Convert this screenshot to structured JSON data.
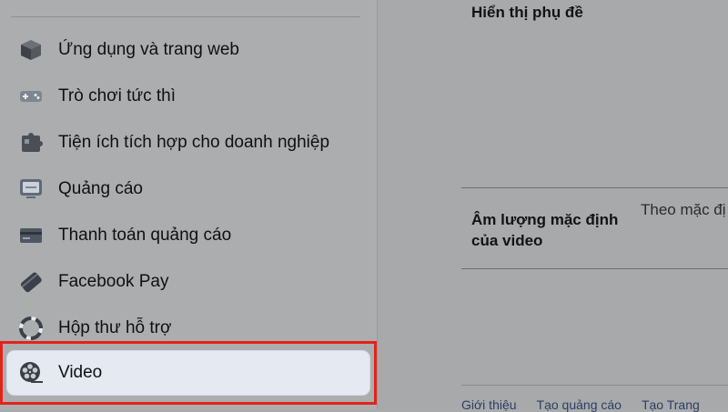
{
  "sidebar": {
    "items": [
      {
        "label": "Ứng dụng và trang web",
        "icon": "cube-icon"
      },
      {
        "label": "Trò chơi tức thì",
        "icon": "gamepad-icon"
      },
      {
        "label": "Tiện ích tích hợp cho doanh nghiệp",
        "icon": "puzzle-icon"
      },
      {
        "label": "Quảng cáo",
        "icon": "ad-monitor-icon"
      },
      {
        "label": "Thanh toán quảng cáo",
        "icon": "credit-card-icon"
      },
      {
        "label": "Facebook Pay",
        "icon": "facebook-pay-icon"
      },
      {
        "label": "Hộp thư hỗ trợ",
        "icon": "lifebuoy-icon"
      },
      {
        "label": "Video",
        "icon": "film-reel-icon",
        "active": true
      }
    ]
  },
  "main": {
    "subtitles_heading": "Hiển thị phụ đề",
    "default_volume_label": "Âm lượng mặc định của video",
    "default_volume_value": "Theo mặc đị"
  },
  "footer": {
    "links": [
      "Giới thiệu",
      "Tạo quảng cáo",
      "Tạo Trang"
    ]
  },
  "colors": {
    "highlight_border": "#e2231a",
    "active_background": "#e4e9f2",
    "footer_link": "#2c3e63"
  }
}
